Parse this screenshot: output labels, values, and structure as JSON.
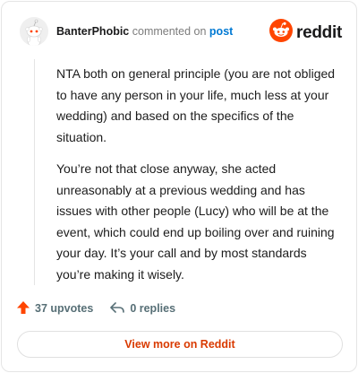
{
  "header": {
    "username": "BanterPhobic",
    "action_text": "commented on",
    "post_link": "post"
  },
  "logo": {
    "wordmark": "reddit",
    "icon": "reddit-snoo-icon",
    "brand_color": "#ff4500"
  },
  "avatar": {
    "icon": "snoo-avatar-icon"
  },
  "comment": {
    "paragraphs": [
      "NTA both on general principle (you are not obliged to have any person in your life, much less at your wedding) and based on the specifics of the situation.",
      "You’re not that close anyway, she acted unreasonably at a previous wedding and has issues with other people (Lucy) who will be at the event, which could end up boiling over and ruining your day. It’s your call and by most standards you’re making it wisely."
    ]
  },
  "actions": {
    "upvotes_label": "37 upvotes",
    "replies_label": "0 replies",
    "upvote_icon": "upvote-arrow-icon",
    "reply_icon": "reply-arrow-icon",
    "upvote_color": "#ff4500"
  },
  "footer": {
    "view_more_label": "View more on Reddit",
    "accent_color": "#d93a00"
  }
}
